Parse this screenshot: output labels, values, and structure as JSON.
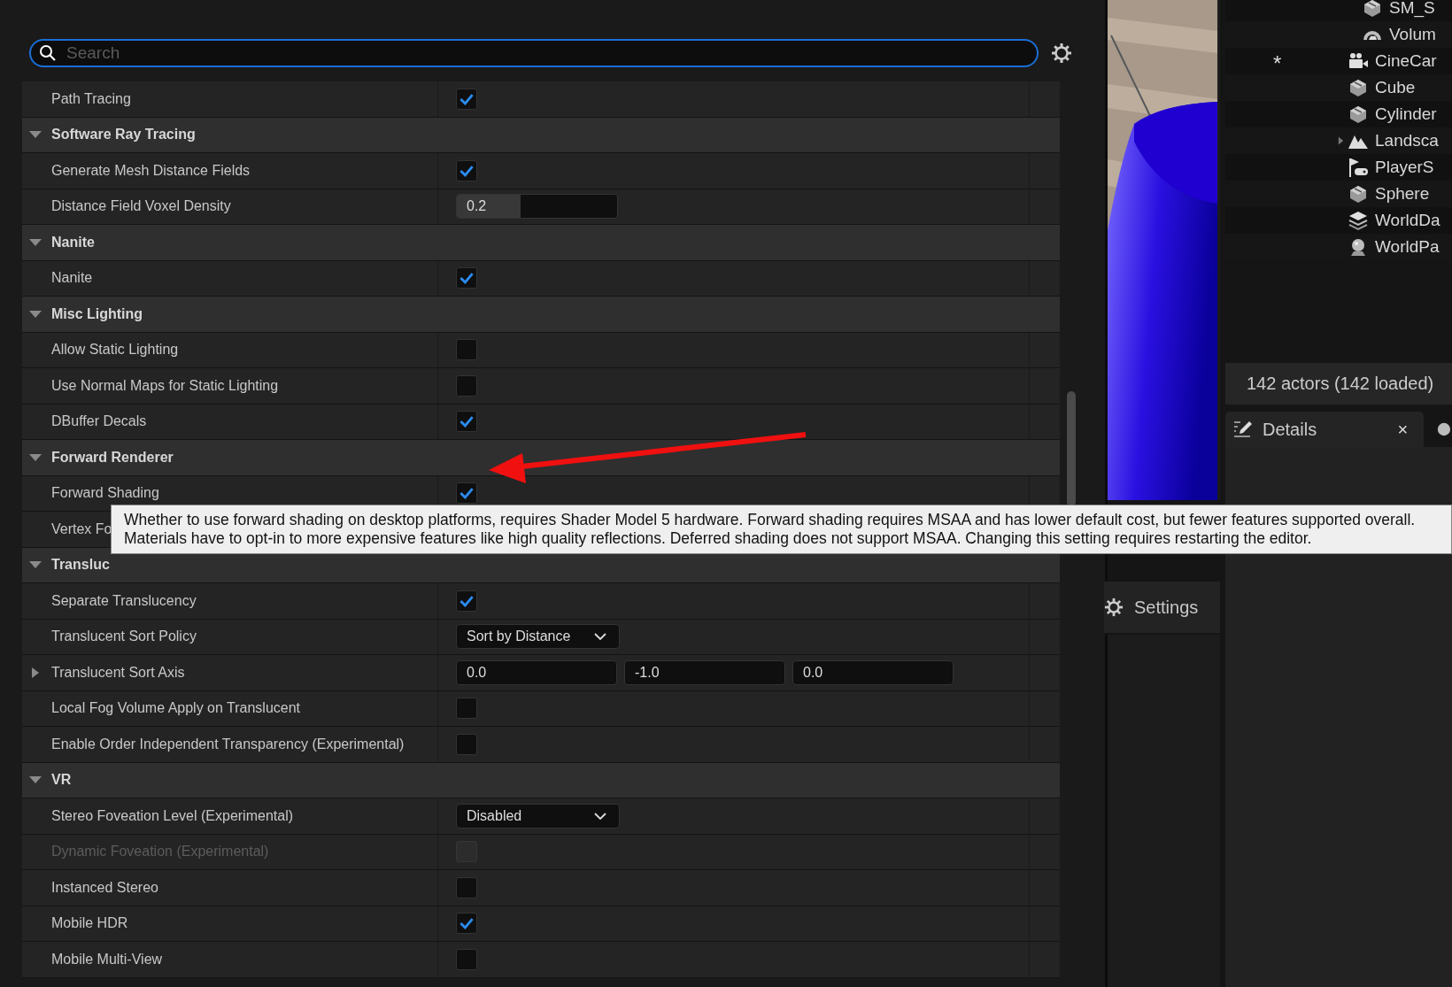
{
  "search": {
    "placeholder": "Search",
    "focused": true
  },
  "rows": [
    {
      "kind": "checkbox",
      "label": "Path Tracing",
      "checked": true,
      "disabled": false
    },
    {
      "kind": "category",
      "label": "Software Ray Tracing",
      "expanded": true
    },
    {
      "kind": "checkbox",
      "label": "Generate Mesh Distance Fields",
      "checked": true,
      "disabled": false
    },
    {
      "kind": "number",
      "label": "Distance Field Voxel Density",
      "value": "0.2",
      "level": 0.4
    },
    {
      "kind": "category",
      "label": "Nanite",
      "expanded": true
    },
    {
      "kind": "checkbox",
      "label": "Nanite",
      "checked": true,
      "disabled": false
    },
    {
      "kind": "category",
      "label": "Misc Lighting",
      "expanded": true
    },
    {
      "kind": "checkbox",
      "label": "Allow Static Lighting",
      "checked": false,
      "disabled": false
    },
    {
      "kind": "checkbox",
      "label": "Use Normal Maps for Static Lighting",
      "checked": false,
      "disabled": false
    },
    {
      "kind": "checkbox",
      "label": "DBuffer Decals",
      "checked": true,
      "disabled": false
    },
    {
      "kind": "category",
      "label": "Forward Renderer",
      "expanded": true
    },
    {
      "kind": "checkbox",
      "label": "Forward Shading",
      "checked": true,
      "disabled": false
    },
    {
      "kind": "label",
      "label": "Vertex Fo"
    },
    {
      "kind": "category",
      "label": "Transluc",
      "expanded": true
    },
    {
      "kind": "checkbox",
      "label": "Separate Translucency",
      "checked": true,
      "disabled": false
    },
    {
      "kind": "dropdown",
      "label": "Translucent Sort Policy",
      "value": "Sort by Distance"
    },
    {
      "kind": "vector",
      "label": "Translucent Sort Axis",
      "values": [
        "0.0",
        "-1.0",
        "0.0"
      ],
      "expanded": false
    },
    {
      "kind": "checkbox",
      "label": "Local Fog Volume Apply on Translucent",
      "checked": false,
      "disabled": false
    },
    {
      "kind": "checkbox",
      "label": "Enable Order Independent Transparency (Experimental)",
      "checked": false,
      "disabled": false
    },
    {
      "kind": "category",
      "label": "VR",
      "expanded": true
    },
    {
      "kind": "dropdown",
      "label": "Stereo Foveation Level (Experimental)",
      "value": "Disabled"
    },
    {
      "kind": "checkbox",
      "label": "Dynamic Foveation (Experimental)",
      "checked": false,
      "disabled": true
    },
    {
      "kind": "checkbox",
      "label": "Instanced Stereo",
      "checked": false,
      "disabled": false
    },
    {
      "kind": "checkbox",
      "label": "Mobile HDR",
      "checked": true,
      "disabled": false
    },
    {
      "kind": "checkbox",
      "label": "Mobile Multi-View",
      "checked": false,
      "disabled": false
    }
  ],
  "tooltip": {
    "lines": [
      "Whether to use forward shading on desktop platforms, requires Shader Model 5 hardware.  Forward shading requires MSAA and has lower default cost, but fewer features supported overall.",
      "Materials have to opt-in to more expensive features like high quality reflections.  Deferred shading does not support MSAA.  Changing this setting requires restarting the editor."
    ]
  },
  "viewport": {
    "kind": "picture",
    "settings_button": "Settings"
  },
  "outliner": {
    "items": [
      {
        "children": [
          {
            "label": "SM_S",
            "kind": "mesh"
          },
          {
            "label": "Volum",
            "kind": "volume"
          }
        ]
      },
      {
        "label": "CineCar",
        "kind": "camera",
        "marker": "*"
      },
      {
        "label": "Cube",
        "kind": "mesh"
      },
      {
        "label": "Cylinder",
        "kind": "mesh"
      },
      {
        "label": "Landsca",
        "kind": "landscape",
        "expanded": false
      },
      {
        "label": "PlayerS",
        "kind": "player"
      },
      {
        "label": "Sphere",
        "kind": "mesh"
      },
      {
        "label": "WorldDa",
        "kind": "layers"
      },
      {
        "label": "WorldPa",
        "kind": "globe"
      }
    ],
    "status": "142 actors (142 loaded)"
  },
  "details_tab": {
    "label": "Details",
    "close": "×"
  }
}
